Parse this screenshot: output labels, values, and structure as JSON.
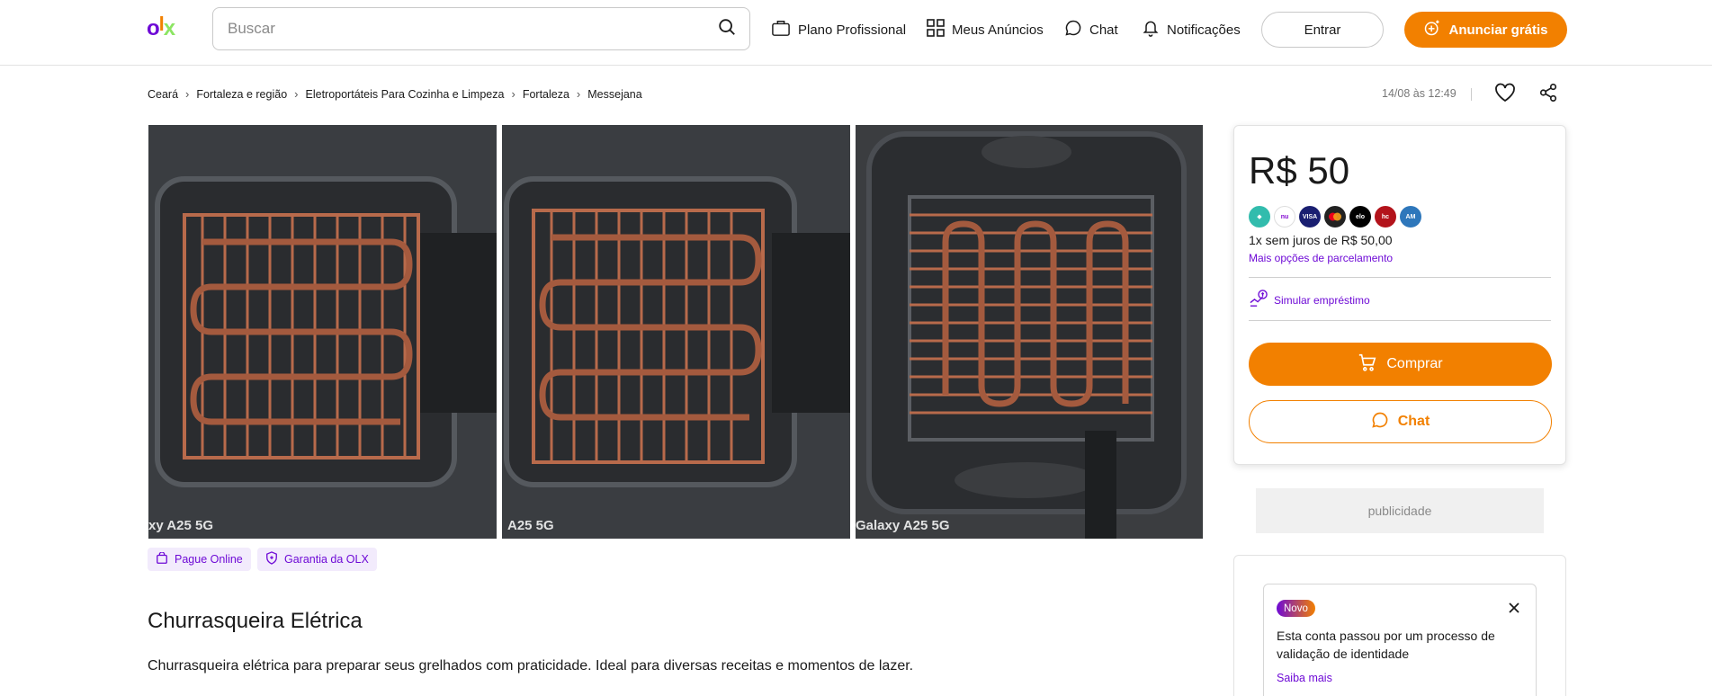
{
  "header": {
    "logo_text": "olx",
    "search_placeholder": "Buscar",
    "nav": {
      "plano_profissional": "Plano Profissional",
      "meus_anuncios": "Meus Anúncios",
      "chat": "Chat",
      "notificacoes": "Notificações"
    },
    "entrar": "Entrar",
    "anunciar": "Anunciar grátis"
  },
  "breadcrumb": [
    "Ceará",
    "Fortaleza e região",
    "Eletroportáteis Para Cozinha e Limpeza",
    "Fortaleza",
    "Messejana"
  ],
  "meta": {
    "date": "14/08 às 12:49"
  },
  "photos": {
    "watermarks": [
      "xy A25 5G",
      "A25 5G",
      "Galaxy A25 5G"
    ]
  },
  "badges": {
    "pague_online": "Pague Online",
    "garantia": "Garantia da OLX"
  },
  "listing": {
    "title": "Churrasqueira Elétrica",
    "description": "Churrasqueira elétrica para preparar seus grelhados com praticidade. Ideal para diversas receitas e momentos de lazer."
  },
  "price_card": {
    "price": "R$ 50",
    "payment_methods": [
      "pix-icon",
      "nubank-icon",
      "visa-icon",
      "mastercard-icon",
      "elo-icon",
      "hipercard-icon",
      "amex-icon"
    ],
    "installment": "1x sem juros de R$ 50,00",
    "more_options": "Mais opções de parcelamento",
    "simular": "Simular empréstimo",
    "comprar": "Comprar",
    "chat": "Chat"
  },
  "ad_label": "publicidade",
  "verification": {
    "badge": "Novo",
    "text": "Esta conta passou por um processo de validação de identidade",
    "link": "Saiba mais"
  },
  "colors": {
    "brand_purple": "#6e0ad6",
    "brand_orange": "#f28000",
    "brand_green": "#8ce563"
  }
}
